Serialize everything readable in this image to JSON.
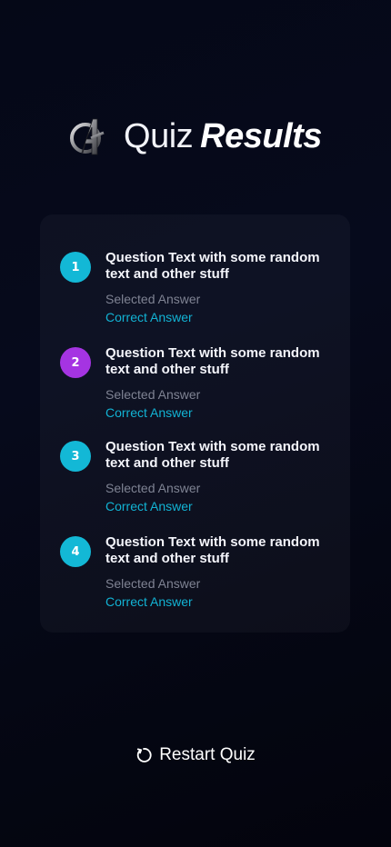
{
  "header": {
    "logo_icon": "avengers-logo-icon",
    "title_light": "Quiz",
    "title_bold": "Results"
  },
  "results": [
    {
      "number": "1",
      "badge_color": "#13b8d6",
      "question": "Question Text with some random text and other stuff",
      "selected_answer": "Selected Answer",
      "correct_answer": "Correct Answer"
    },
    {
      "number": "2",
      "badge_color": "#a534e2",
      "question": "Question Text with some random text and other stuff",
      "selected_answer": "Selected Answer",
      "correct_answer": "Correct Answer"
    },
    {
      "number": "3",
      "badge_color": "#13b8d6",
      "question": "Question Text with some random text and other stuff",
      "selected_answer": "Selected Answer",
      "correct_answer": "Correct Answer"
    },
    {
      "number": "4",
      "badge_color": "#13b8d6",
      "question": "Question Text with some random text and other stuff",
      "selected_answer": "Selected Answer",
      "correct_answer": "Correct Answer"
    }
  ],
  "restart": {
    "icon": "restart-icon",
    "label": "Restart Quiz"
  },
  "colors": {
    "background": "#050817",
    "correct_answer": "#12b3d4",
    "selected_answer": "#7f8393"
  }
}
